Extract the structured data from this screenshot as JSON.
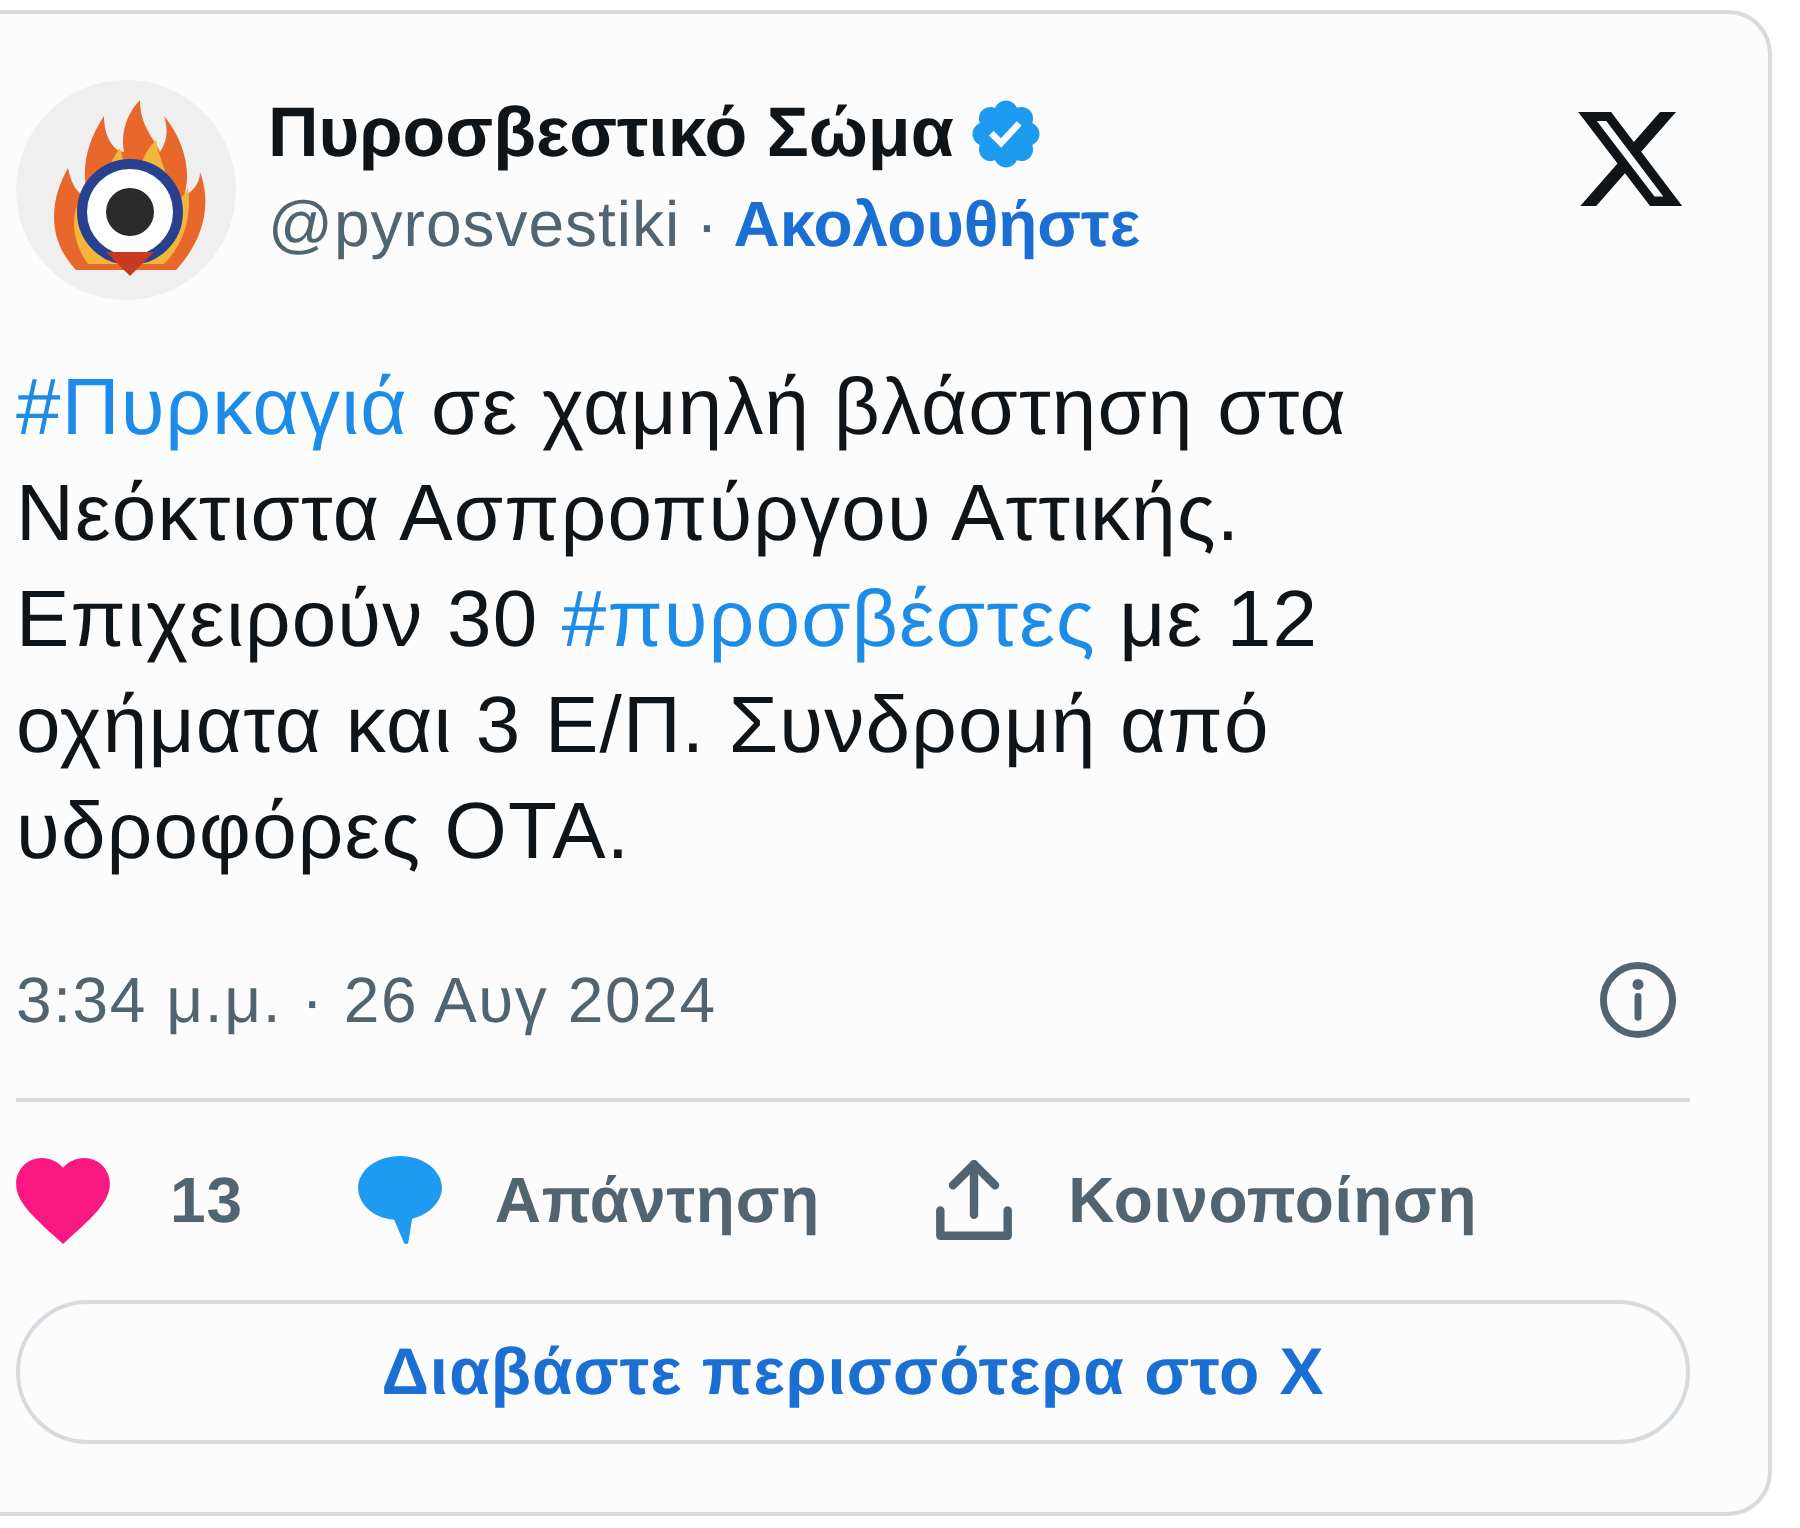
{
  "author": {
    "name": "Πυροσβεστικό Σώμα",
    "verified": true,
    "handle": "@pyrosvestiki",
    "separator": "·",
    "follow_label": "Ακολουθήστε"
  },
  "tweet": {
    "segments": [
      {
        "kind": "hashtag",
        "text": "#Πυρκαγιά"
      },
      {
        "kind": "text",
        "text": " σε χαμηλή βλάστηση στα Νεόκτιστα Ασπροπύργου Αττικής. Επιχειρούν 30 "
      },
      {
        "kind": "hashtag",
        "text": "#πυροσβέστες"
      },
      {
        "kind": "text",
        "text": " με 12 οχήματα και 3 Ε/Π. Συνδρομή από υδροφόρες ΟΤΑ."
      }
    ]
  },
  "timestamp": "3:34 μ.μ. · 26 Αυγ 2024",
  "actions": [
    {
      "kind": "like",
      "label": "13"
    },
    {
      "kind": "reply",
      "label": "Απάντηση"
    },
    {
      "kind": "share",
      "label": "Κοινοποίηση"
    }
  ],
  "read_more": "Διαβάστε περισσότερα στο X"
}
